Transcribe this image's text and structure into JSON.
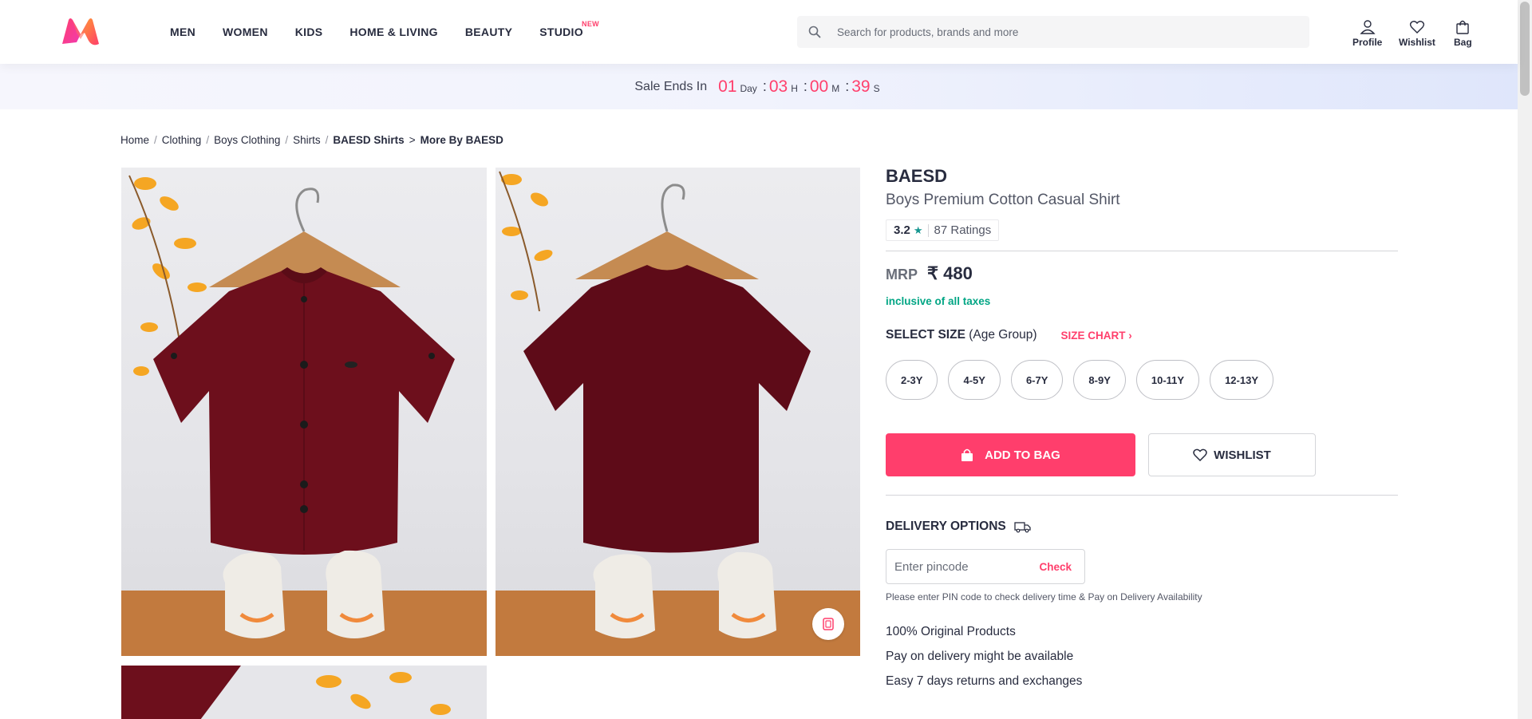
{
  "header": {
    "nav": [
      {
        "label": "MEN"
      },
      {
        "label": "WOMEN"
      },
      {
        "label": "KIDS"
      },
      {
        "label": "HOME & LIVING"
      },
      {
        "label": "BEAUTY"
      },
      {
        "label": "STUDIO",
        "badge": "NEW"
      }
    ],
    "search_placeholder": "Search for products, brands and more",
    "actions": {
      "profile": "Profile",
      "wishlist": "Wishlist",
      "bag": "Bag"
    }
  },
  "sale": {
    "label": "Sale Ends In",
    "day": "01",
    "day_unit": "Day",
    "hours": "03",
    "hours_unit": "H",
    "minutes": "00",
    "minutes_unit": "M",
    "seconds": "39",
    "seconds_unit": "S"
  },
  "breadcrumb": [
    "Home",
    "Clothing",
    "Boys Clothing",
    "Shirts",
    "BAESD Shirts",
    "More By BAESD"
  ],
  "product": {
    "brand": "BAESD",
    "name": "Boys Premium Cotton Casual Shirt",
    "rating": "3.2",
    "ratings_count": "87 Ratings",
    "mrp_label": "MRP",
    "price": "₹ 480",
    "tax_note": "inclusive of all taxes",
    "size_title": "SELECT SIZE",
    "size_sub": "(Age Group)",
    "size_chart": "SIZE CHART",
    "sizes": [
      "2-3Y",
      "4-5Y",
      "6-7Y",
      "8-9Y",
      "10-11Y",
      "12-13Y"
    ],
    "add_to_bag": "ADD TO BAG",
    "wishlist": "WISHLIST"
  },
  "delivery": {
    "title": "DELIVERY OPTIONS",
    "pincode_placeholder": "Enter pincode",
    "check": "Check",
    "note": "Please enter PIN code to check delivery time & Pay on Delivery Availability",
    "features": [
      "100% Original Products",
      "Pay on delivery might be available",
      "Easy 7 days returns and exchanges"
    ]
  },
  "colors": {
    "accent": "#ff3f6c",
    "shirt": "#6d0f1c",
    "tax_green": "#03a685"
  }
}
